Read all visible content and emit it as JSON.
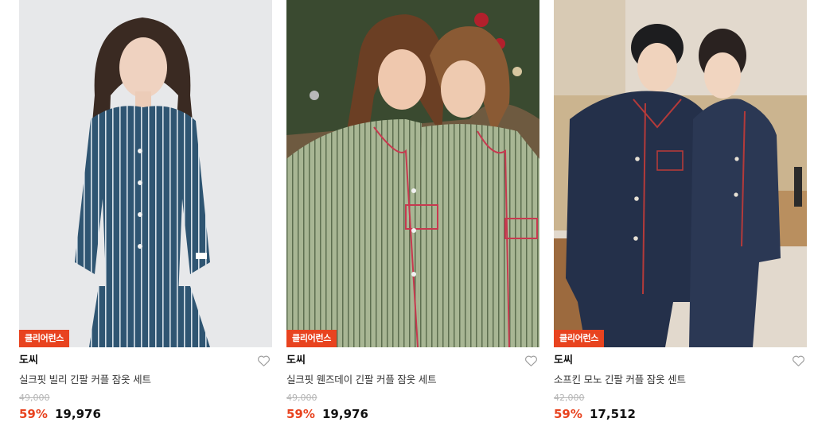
{
  "products": [
    {
      "badge": "클리어런스",
      "brand": "도씨",
      "title": "실크핏 빌리 긴팔 커플 잠옷 세트",
      "original_price": "49,000",
      "discount": "59%",
      "price": "19,976",
      "image": "woman-blue-striped-pajamas"
    },
    {
      "badge": "클리어런스",
      "brand": "도씨",
      "title": "실크핏 웬즈데이 긴팔 커플 잠옷 세트",
      "original_price": "49,000",
      "discount": "59%",
      "price": "19,976",
      "image": "couple-green-striped-pajamas"
    },
    {
      "badge": "클리어런스",
      "brand": "도씨",
      "title": "소프킨 모노 긴팔 커플 잠옷 센트",
      "original_price": "42,000",
      "discount": "59%",
      "price": "17,512",
      "image": "couple-navy-pajamas"
    }
  ],
  "colors": {
    "accent": "#e8431f",
    "badge_bg": "#e8431f",
    "strike_text": "#b5b5b5"
  },
  "icons": {
    "wishlist": "heart-outline-icon"
  }
}
